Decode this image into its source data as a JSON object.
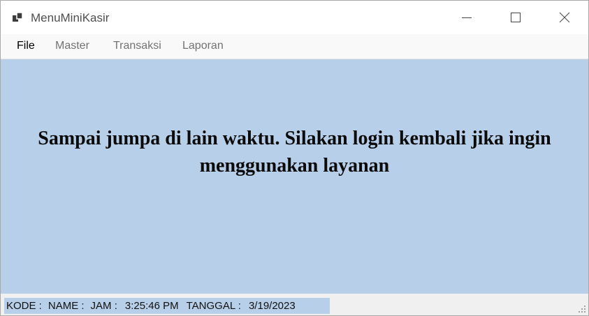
{
  "window": {
    "title": "MenuMiniKasir",
    "icon": "app-window-icon"
  },
  "menu": {
    "items": [
      "File",
      "Master",
      "Transaksi",
      "Laporan"
    ]
  },
  "content": {
    "message": "Sampai jumpa di lain waktu. Silakan login kembali jika ingin menggunakan layanan",
    "background_color": "#b8cfe9"
  },
  "status": {
    "kode_label": "KODE :",
    "name_label": "NAME :",
    "jam_label": "JAM :",
    "jam_value": "3:25:46 PM",
    "tanggal_label": "TANGGAL :",
    "tanggal_value": "3/19/2023"
  }
}
